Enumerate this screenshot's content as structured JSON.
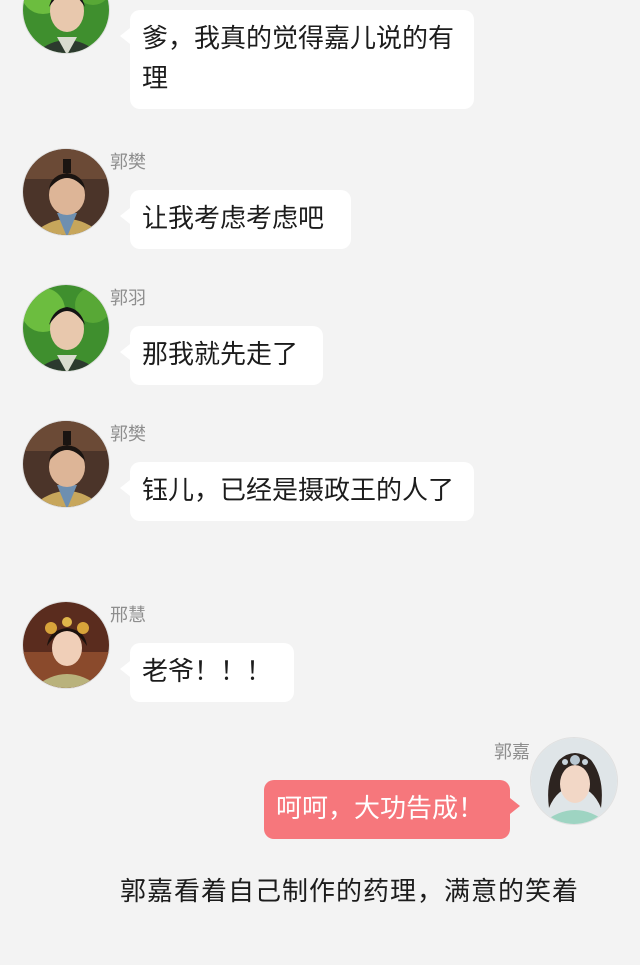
{
  "messages": [
    {
      "side": "left",
      "speaker": "",
      "avatar": "guo-yu-avatar-icon",
      "text": "爹，我真的觉得嘉儿说的有理"
    },
    {
      "side": "left",
      "speaker": "郭樊",
      "avatar": "guo-fan-avatar-icon",
      "text": "让我考虑考虑吧"
    },
    {
      "side": "left",
      "speaker": "郭羽",
      "avatar": "guo-yu-avatar-icon",
      "text": "那我就先走了"
    },
    {
      "side": "left",
      "speaker": "郭樊",
      "avatar": "guo-fan-avatar-icon",
      "text": "钰儿，已经是摄政王的人了"
    },
    {
      "side": "left",
      "speaker": "邢慧",
      "avatar": "xing-hui-avatar-icon",
      "text": "老爷！！！"
    },
    {
      "side": "right",
      "speaker": "郭嘉",
      "avatar": "guo-jia-avatar-icon",
      "text": "呵呵，大功告成！"
    }
  ],
  "narration": "郭嘉看着自己制作的药理，满意的笑着",
  "colors": {
    "background": "#f3f3f3",
    "bubble_left": "#ffffff",
    "bubble_right": "#f6777c",
    "name_text": "#8e8e8e"
  }
}
